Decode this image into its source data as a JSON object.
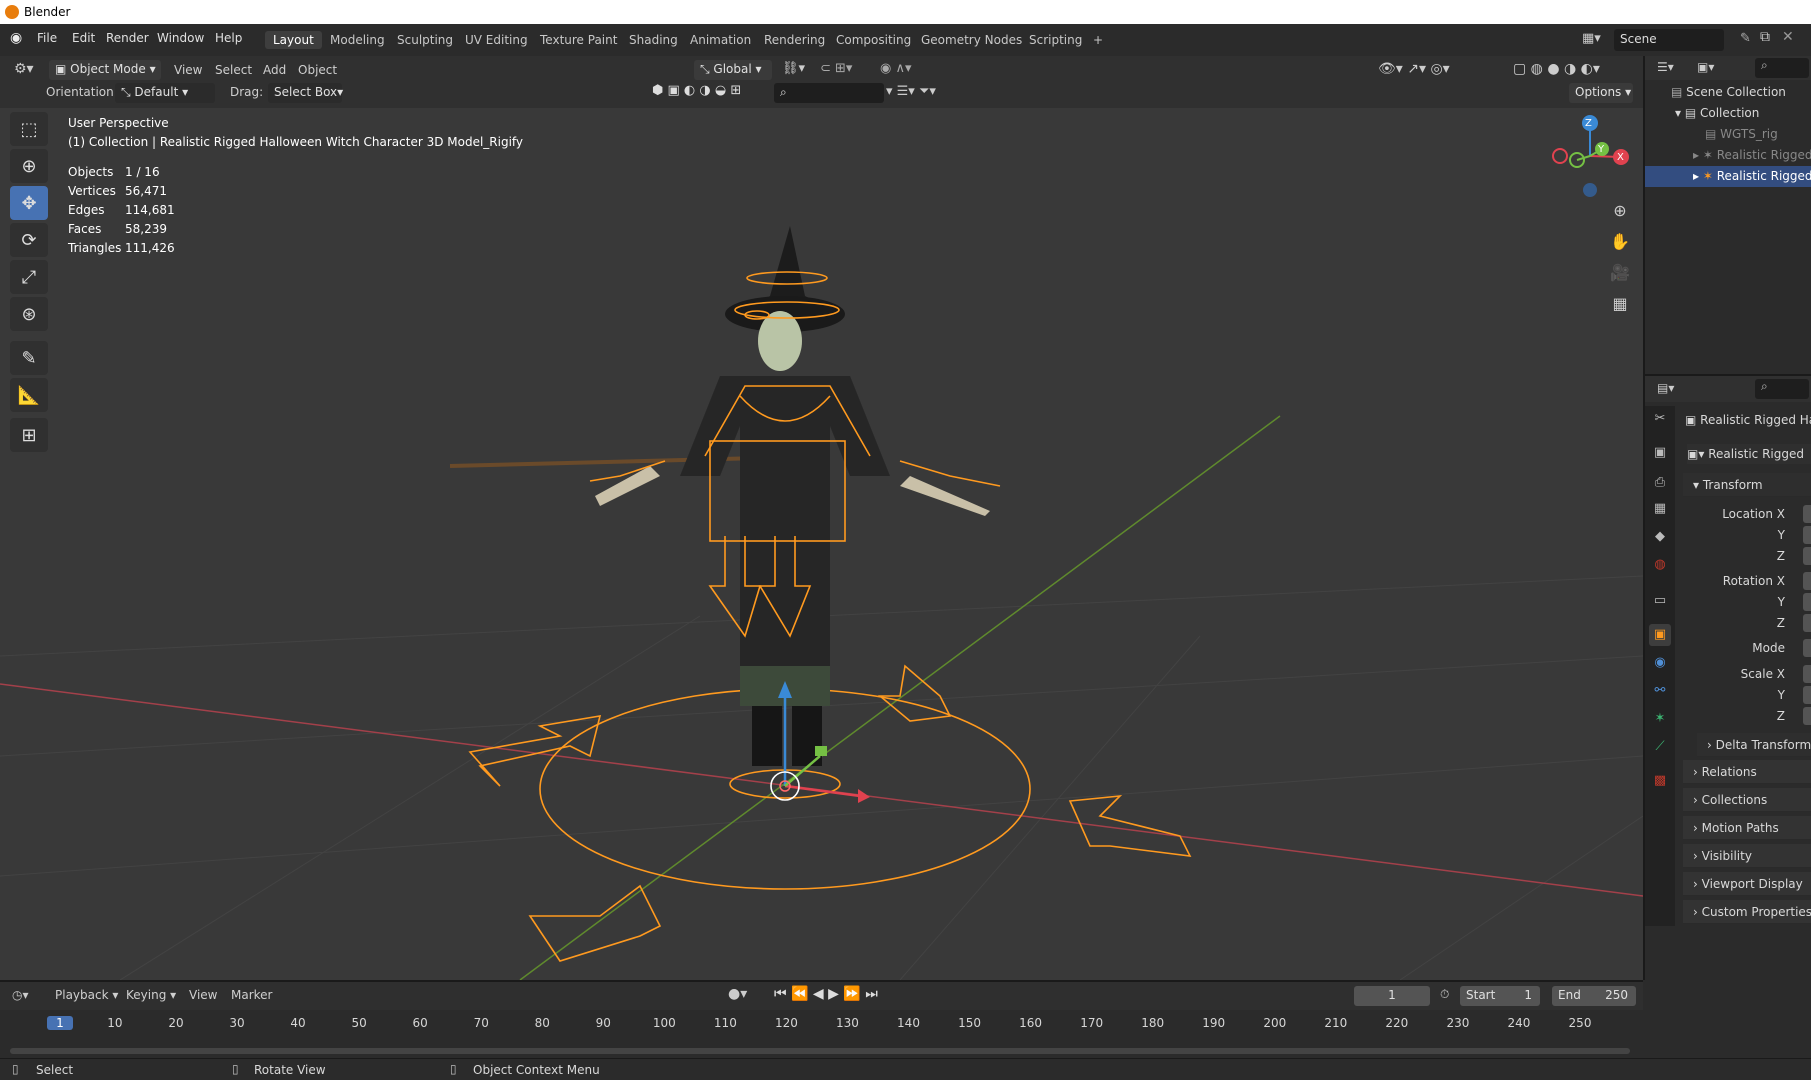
{
  "window": {
    "title": "Blender"
  },
  "menus": [
    "File",
    "Edit",
    "Render",
    "Window",
    "Help"
  ],
  "workspaces": [
    "Layout",
    "Modeling",
    "Sculpting",
    "UV Editing",
    "Texture Paint",
    "Shading",
    "Animation",
    "Rendering",
    "Compositing",
    "Geometry Nodes",
    "Scripting",
    "+"
  ],
  "scene": {
    "label": "Scene"
  },
  "viewport_header": {
    "mode": "Object Mode",
    "view": "View",
    "select": "Select",
    "add": "Add",
    "object": "Object",
    "transform_orientation": "Global",
    "orientation_label": "Orientation:",
    "orientation_value": "Default",
    "drag_label": "Drag:",
    "drag_value": "Select Box",
    "options": "Options"
  },
  "overlay": {
    "perspective": "User Perspective",
    "collection_line": "(1) Collection | Realistic Rigged Halloween Witch Character 3D Model_Rigify",
    "stats": [
      {
        "label": "Objects",
        "value": "1 / 16"
      },
      {
        "label": "Vertices",
        "value": "56,471"
      },
      {
        "label": "Edges",
        "value": "114,681"
      },
      {
        "label": "Faces",
        "value": "58,239"
      },
      {
        "label": "Triangles",
        "value": "111,426"
      }
    ]
  },
  "gizmo": {
    "z": "Z",
    "y": "Y",
    "x": "X"
  },
  "outliner": {
    "scene_collection": "Scene Collection",
    "collection": "Collection",
    "items": [
      "WGTS_rig",
      "Realistic Rigged",
      "Realistic Rigged"
    ]
  },
  "properties": {
    "object_name": "Realistic Rigged Ha",
    "data_name": "Realistic Rigged",
    "transform": "Transform",
    "location_x": "Location X",
    "y": "Y",
    "z": "Z",
    "rotation_x": "Rotation X",
    "mode": "Mode",
    "scale_x": "Scale X",
    "panels": [
      "Delta Transform",
      "Relations",
      "Collections",
      "Motion Paths",
      "Visibility",
      "Viewport Display",
      "Custom Properties"
    ]
  },
  "timeline": {
    "playback": "Playback",
    "keying": "Keying",
    "view": "View",
    "marker": "Marker",
    "current_frame": "1",
    "start_label": "Start",
    "start": "1",
    "end_label": "End",
    "end": "250",
    "ticks": [
      "1",
      "10",
      "20",
      "30",
      "40",
      "50",
      "60",
      "70",
      "80",
      "90",
      "100",
      "110",
      "120",
      "130",
      "140",
      "150",
      "160",
      "170",
      "180",
      "190",
      "200",
      "210",
      "220",
      "230",
      "240",
      "250"
    ]
  },
  "statusbar": {
    "select": "Select",
    "rotate": "Rotate View",
    "context": "Object Context Menu"
  },
  "colors": {
    "accent": "#4772b3",
    "rig": "#ff9a1f",
    "xaxis": "#c8484e",
    "yaxis": "#6c9a30"
  }
}
